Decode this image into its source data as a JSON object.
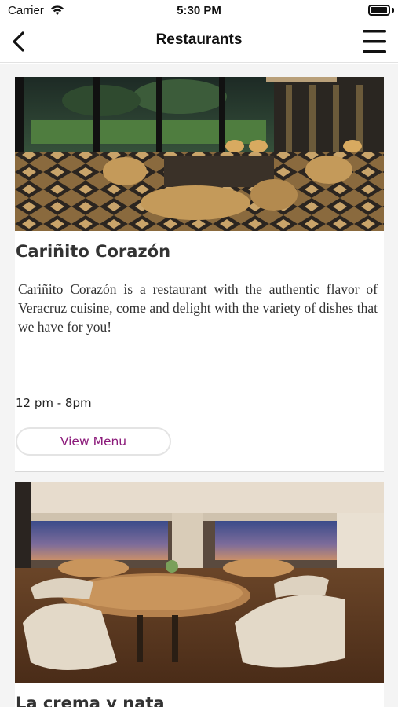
{
  "status_bar": {
    "carrier": "Carrier",
    "time": "5:30 PM"
  },
  "nav": {
    "title": "Restaurants"
  },
  "restaurants": [
    {
      "name": "Cariñito Corazón",
      "description": "Cariñito Corazón is a restaurant with the authentic flavor of Veracruz cuisine, come and delight with the variety of dishes that we have for you!",
      "hours": "12 pm - 8pm",
      "button_label": "View Menu"
    },
    {
      "name": "La crema y nata"
    }
  ],
  "colors": {
    "accent": "#8b1a7a",
    "background": "#f4f4f4"
  }
}
